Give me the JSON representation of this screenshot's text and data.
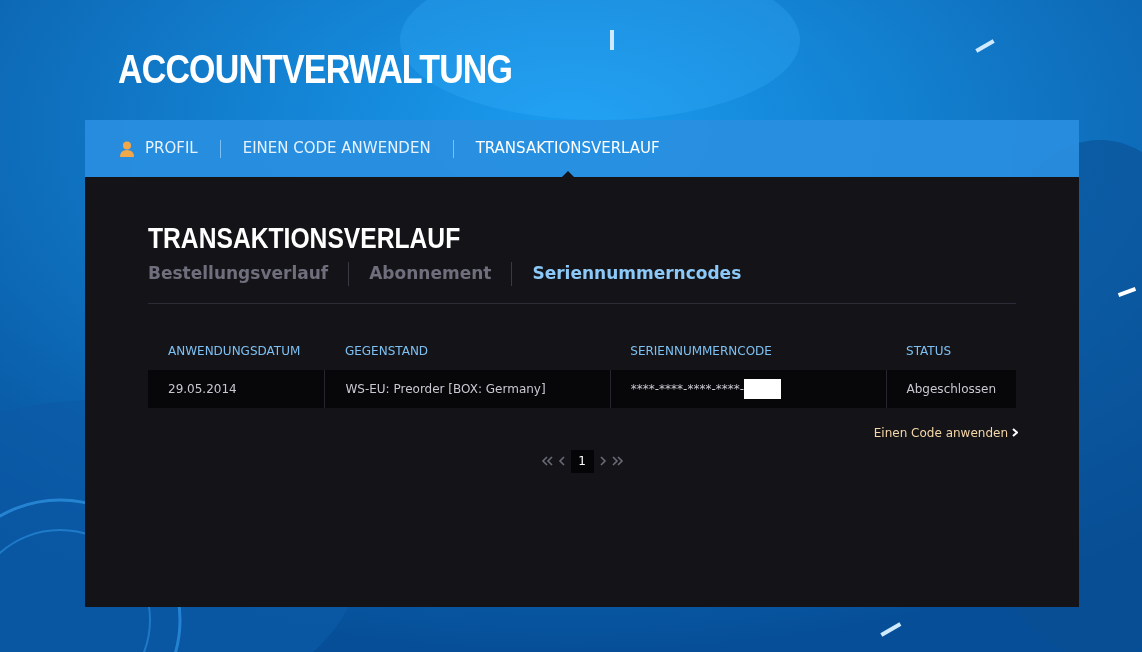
{
  "page_title": "ACCOUNTVERWALTUNG",
  "nav_tabs": [
    {
      "label": "PROFIL",
      "kind": "profile",
      "selected": false
    },
    {
      "label": "EINEN CODE ANWENDEN",
      "kind": "plain",
      "selected": false
    },
    {
      "label": "TRANSAKTIONSVERLAUF",
      "kind": "plain",
      "selected": true
    }
  ],
  "section_title": "TRANSAKTIONSVERLAUF",
  "sub_tabs": [
    {
      "label": "Bestellungsverlauf",
      "selected": false
    },
    {
      "label": "Abonnement",
      "selected": false
    },
    {
      "label": "Seriennummerncodes",
      "selected": true
    }
  ],
  "table": {
    "columns": [
      "ANWENDUNGSDATUM",
      "GEGENSTAND",
      "SERIENNUMMERNCODE",
      "STATUS"
    ],
    "rows": [
      {
        "cells": [
          "29.05.2014",
          "WS-EU: Preorder [BOX: Germany]",
          "****-****-****-****-",
          "Abgeschlossen"
        ],
        "code_redacted": true
      }
    ]
  },
  "apply_code_link": "Einen Code anwenden",
  "pagination": {
    "pages": [
      {
        "label": "1",
        "selected": true
      }
    ]
  }
}
